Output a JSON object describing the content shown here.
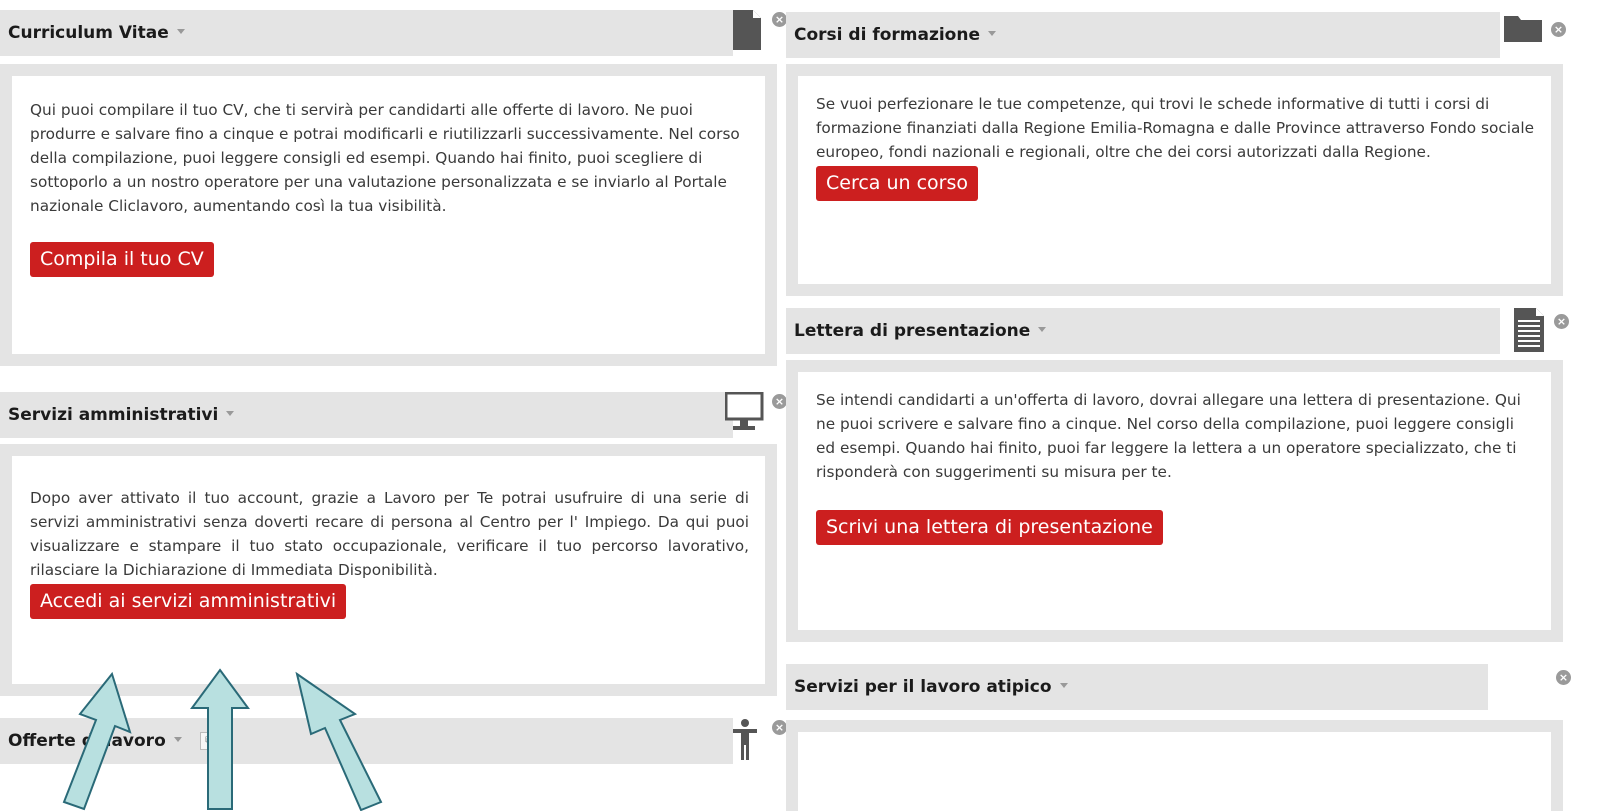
{
  "widgets": {
    "cv": {
      "title": "Curriculum Vitae",
      "text": "Qui puoi compilare il tuo CV, che ti servirà per candidarti alle offerte di lavoro. Ne puoi produrre e salvare fino a cinque e potrai modificarli e riutilizzarli successivamente. Nel corso della compilazione, puoi leggere consigli ed esempi. Quando hai finito, puoi scegliere di sottoporlo a un nostro operatore per una valutazione personalizzata e se inviarlo al Portale nazionale Cliclavoro, aumentando così la tua visibilità.",
      "button": "Compila il tuo CV",
      "icon": "document-icon"
    },
    "servizi": {
      "title": "Servizi amministrativi",
      "text": "Dopo aver attivato il tuo account, grazie a Lavoro per Te potrai usufruire di una serie di servizi amministrativi senza doverti recare di persona al Centro per l' Impiego. Da qui puoi visualizzare e stampare il tuo stato occupazionale, verificare il tuo percorso lavorativo, rilasciare la Dichiarazione di Immediata Disponibilità.",
      "button": "Accedi ai servizi amministrativi",
      "icon": "monitor-icon"
    },
    "offerte": {
      "title": "Offerte di lavoro",
      "icon": "person-icon"
    },
    "corsi": {
      "title": "Corsi di formazione",
      "text": "Se vuoi perfezionare le tue competenze, qui trovi le schede informative di tutti i corsi di formazione finanziati dalla Regione Emilia-Romagna e dalle Province attraverso Fondo sociale europeo, fondi nazionali e regionali, oltre che dei corsi autorizzati dalla Regione.",
      "button": "Cerca un corso",
      "icon": "folder-icon"
    },
    "lettera": {
      "title": "Lettera di presentazione",
      "text": "Se intendi candidarti a un'offerta di lavoro, dovrai allegare una lettera di presentazione. Qui ne puoi scrivere e salvare fino a cinque. Nel corso della compilazione, puoi leggere consigli ed esempi. Quando hai finito, puoi far leggere la lettera a un operatore specializzato, che ti risponderà con suggerimenti su misura per te.",
      "button": "Scrivi una lettera di presentazione",
      "icon": "text-document-icon"
    },
    "atipico": {
      "title": "Servizi per il lavoro atipico"
    }
  },
  "colors": {
    "header_bg": "#e4e4e4",
    "button_bg": "#cc1f1f",
    "arrow_fill": "#b8e0e0",
    "arrow_stroke": "#2a6a78"
  }
}
